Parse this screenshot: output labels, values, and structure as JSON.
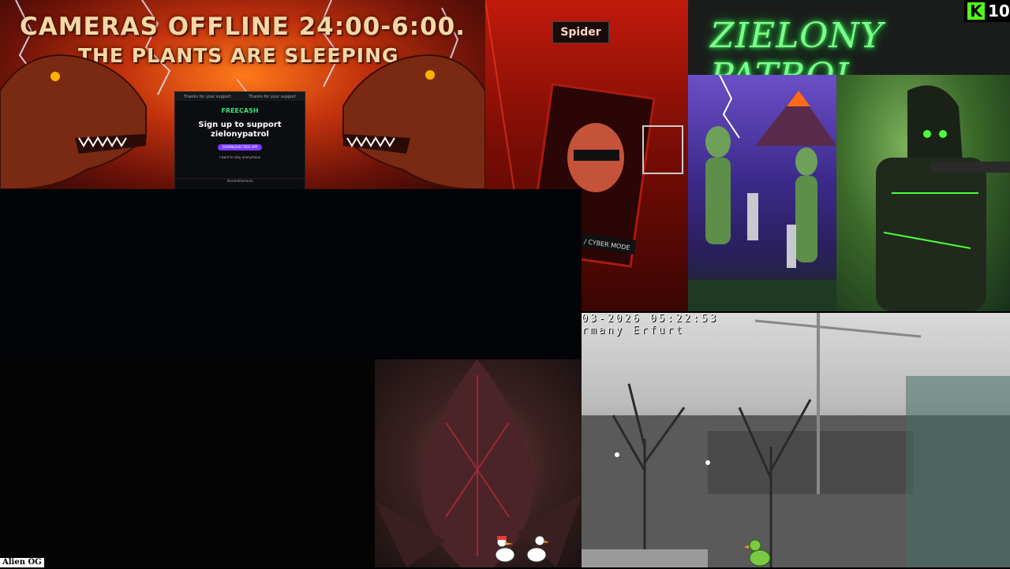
{
  "banner": {
    "line1": "CAMERAS OFFLINE 24:00-6:00.",
    "line2": "THE PLANTS ARE SLEEPING."
  },
  "freecash": {
    "topbar_text_1": "Thanks for your support",
    "topbar_text_2": "Thanks for your support",
    "brand": "FREECASH",
    "title": "Sign up to support zielonypatrol",
    "cta": "DOWNLOAD FREE APP",
    "small": "I want to stay anonymous",
    "footer": "StreamElements"
  },
  "red_panel": {
    "label": "Spider",
    "sign": "/ CYBER MODE"
  },
  "zielony": {
    "neon_text": "ZIELONY PATROL"
  },
  "kick": {
    "logo": "K",
    "count": "10"
  },
  "webcam": {
    "timestamp": "03-2026 05:22:53",
    "location": "rmany Erfurt"
  },
  "footer_label": "Alien OG",
  "colors": {
    "kick_green": "#53fc18",
    "neon_green": "#7dff8a",
    "freecash_purple": "#7a3cff"
  }
}
